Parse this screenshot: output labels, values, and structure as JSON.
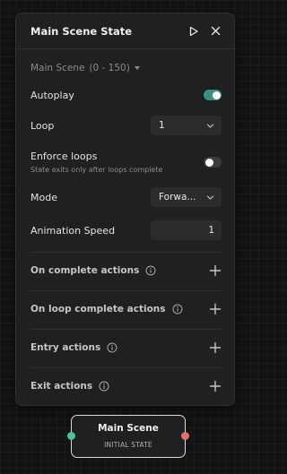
{
  "panel": {
    "title": "Main Scene State",
    "scene_label": "Main Scene",
    "scene_range": "(0 - 150)"
  },
  "autoplay": {
    "label": "Autoplay",
    "enabled": true
  },
  "loop": {
    "label": "Loop",
    "value": "1"
  },
  "enforce_loops": {
    "label": "Enforce loops",
    "description": "State exits only after loops complete",
    "enabled": false
  },
  "mode": {
    "label": "Mode",
    "value": "Forwa..."
  },
  "animation_speed": {
    "label": "Animation Speed",
    "value": "1"
  },
  "actions": [
    {
      "label": "On complete actions"
    },
    {
      "label": "On loop complete actions"
    },
    {
      "label": "Entry actions"
    },
    {
      "label": "Exit actions"
    }
  ],
  "node": {
    "title": "Main Scene",
    "subtitle": "INITIAL STATE"
  },
  "colors": {
    "accent": "#3d8f7f",
    "port_in": "#4fbf9a",
    "port_out": "#e0706a",
    "panel_bg": "#1f2021",
    "canvas_bg": "#121314"
  },
  "icons": {
    "play": "play-icon",
    "close": "close-icon",
    "caret": "caret-down-icon",
    "chevron": "chevron-down-icon",
    "info": "info-icon",
    "plus": "plus-icon"
  }
}
